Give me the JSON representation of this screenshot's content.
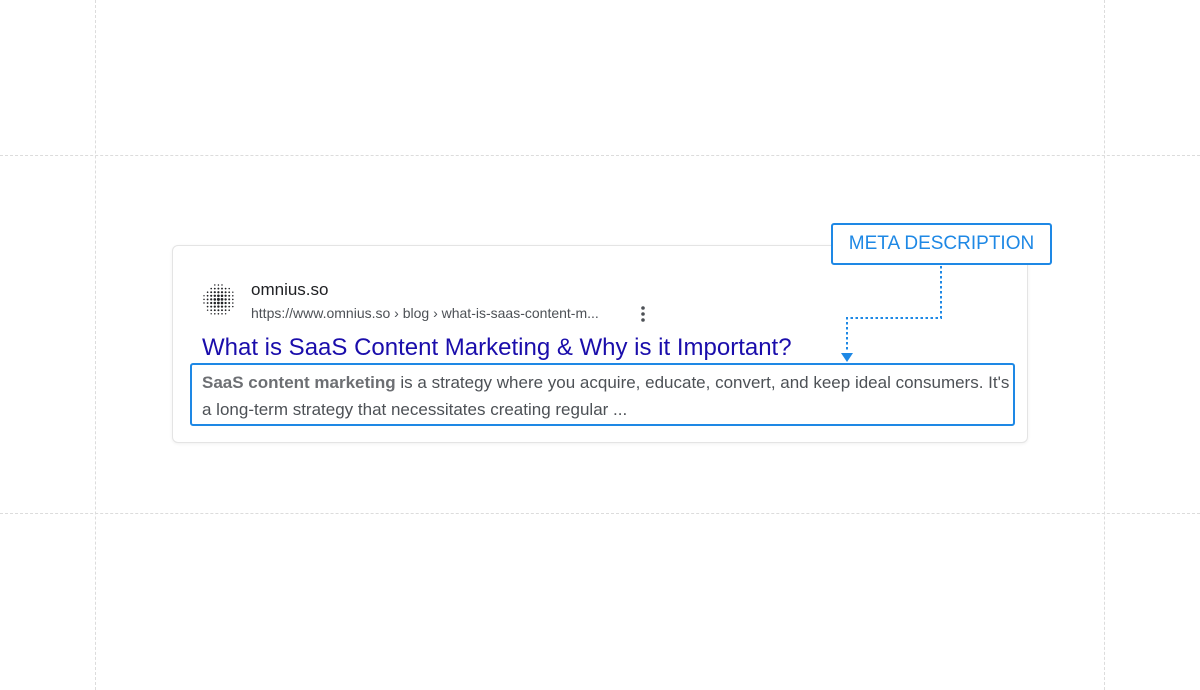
{
  "result": {
    "site_name": "omnius.so",
    "url": "https://www.omnius.so › blog › what-is-saas-content-m...",
    "title": "What is SaaS Content Marketing & Why is it Important?",
    "snippet_bold": "SaaS content marketing",
    "snippet_rest": " is a strategy where you acquire, educate, convert, and keep ideal consumers. It's a long-term strategy that necessitates creating regular ..."
  },
  "annotation": {
    "label": "META DESCRIPTION"
  },
  "icons": {
    "favicon": "omnius-dotted-sphere-logo",
    "menu": "three-dots-vertical-icon"
  },
  "colors": {
    "accent": "#1e88e5",
    "link": "#1a0dab",
    "text": "#4d5156",
    "site_name": "#202124",
    "guide": "#dcdcdc"
  }
}
